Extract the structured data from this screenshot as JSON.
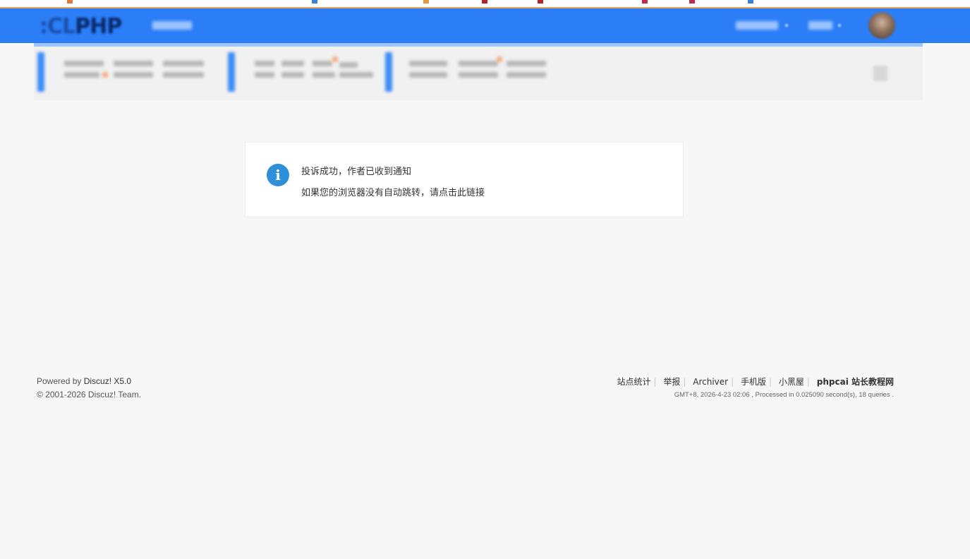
{
  "header": {
    "logo_text": "PHP"
  },
  "message": {
    "icon": "info-icon",
    "title": "投诉成功，作者已收到通知",
    "redirect_link": "如果您的浏览器没有自动跳转，请点击此链接"
  },
  "footer": {
    "powered_prefix": "Powered by ",
    "powered_brand": "Discuz! X5.0",
    "copyright": "© 2001-2026 Discuz! Team.",
    "links": [
      "站点统计",
      "举报",
      "Archiver",
      "手机版",
      "小黑屋"
    ],
    "site_name": "phpcai 站长教程网",
    "info": "GMT+8, 2026-4-23 02:06 , Processed in 0.025090 second(s), 18 queries ."
  },
  "colors": {
    "header_bg": "#2b7ef6",
    "info_icon": "#2f8fd8",
    "page_bg": "#f7f7f7"
  }
}
